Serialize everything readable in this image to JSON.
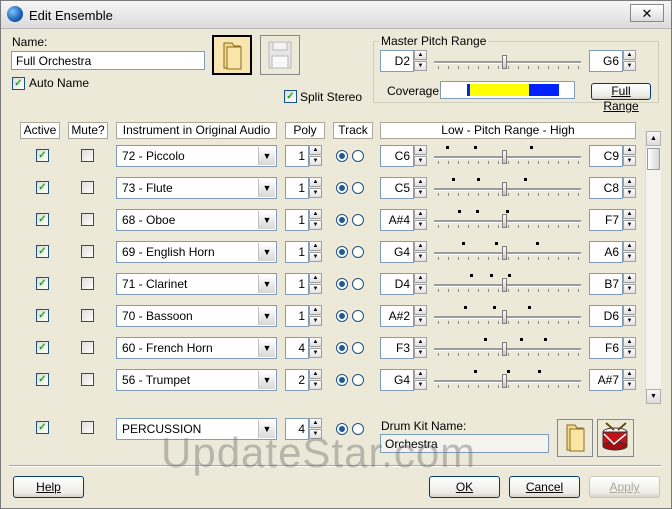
{
  "window": {
    "title": "Edit Ensemble",
    "close": "✕"
  },
  "name": {
    "label": "Name:",
    "value": "Full Orchestra"
  },
  "auto_name": {
    "label": "Auto Name",
    "checked": true
  },
  "split_stereo": {
    "label": "Split Stereo",
    "checked": true
  },
  "master": {
    "label": "Master Pitch Range",
    "low": "D2",
    "high": "G6",
    "coverage_label": "Coverage:",
    "full_range_label": "Full Range"
  },
  "columns": {
    "active": "Active",
    "mute": "Mute?",
    "instrument": "Instrument in Original Audio",
    "poly": "Poly",
    "track": "Track",
    "range": "Low - Pitch Range - High"
  },
  "rows": [
    {
      "active": true,
      "mute": false,
      "instrument": "72 - Piccolo",
      "poly": "1",
      "low": "C6",
      "high": "C9"
    },
    {
      "active": true,
      "mute": false,
      "instrument": "73 - Flute",
      "poly": "1",
      "low": "C5",
      "high": "C8"
    },
    {
      "active": true,
      "mute": false,
      "instrument": "68 - Oboe",
      "poly": "1",
      "low": "A#4",
      "high": "F7"
    },
    {
      "active": true,
      "mute": false,
      "instrument": "69 - English Horn",
      "poly": "1",
      "low": "G4",
      "high": "A6"
    },
    {
      "active": true,
      "mute": false,
      "instrument": "71 - Clarinet",
      "poly": "1",
      "low": "D4",
      "high": "B7"
    },
    {
      "active": true,
      "mute": false,
      "instrument": "70 - Bassoon",
      "poly": "1",
      "low": "A#2",
      "high": "D6"
    },
    {
      "active": true,
      "mute": false,
      "instrument": "60 - French Horn",
      "poly": "4",
      "low": "F3",
      "high": "F6"
    },
    {
      "active": true,
      "mute": false,
      "instrument": "56 - Trumpet",
      "poly": "2",
      "low": "G4",
      "high": "A#7"
    }
  ],
  "percussion": {
    "active": true,
    "mute": false,
    "instrument": "PERCUSSION",
    "poly": "4",
    "drum_kit_label": "Drum Kit Name:",
    "drum_kit_value": "Orchestra"
  },
  "buttons": {
    "help": "Help",
    "ok": "OK",
    "cancel": "Cancel",
    "apply": "Apply"
  },
  "watermark": "UpdateStar.com",
  "colors": {
    "coverage_yellow": "#ffff00",
    "coverage_blue": "#0022ff",
    "check_green": "#21a121",
    "radio_blue": "#1c5a9e"
  }
}
